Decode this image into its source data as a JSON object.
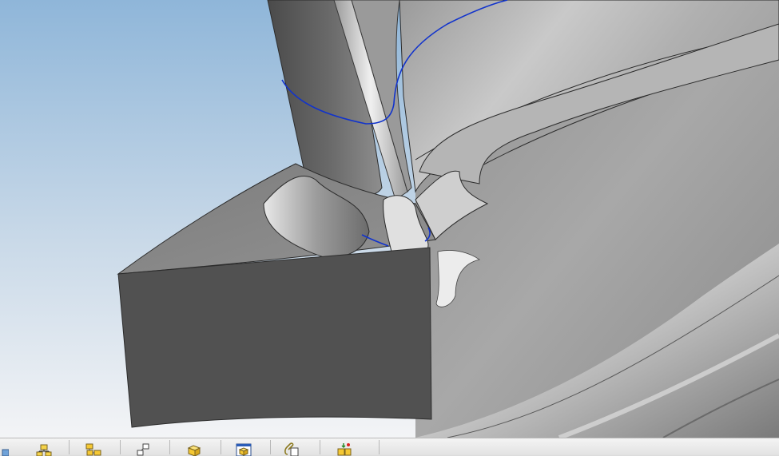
{
  "app": {
    "view": "3d-model-viewport",
    "colors": {
      "background_top": "#8fb6d9",
      "background_bottom": "#f3f4f6",
      "edge_curve": "#1133cc",
      "surface_dark": "#515151",
      "surface_light": "#cfcfcf"
    }
  },
  "toolbar": {
    "buttons": [
      {
        "name": "partial-icon-button",
        "icon": "cube-edge-icon"
      },
      {
        "name": "assembly-tree-button",
        "icon": "hierarchy-icon"
      },
      {
        "name": "components-button",
        "icon": "yellow-blocks-icon"
      },
      {
        "name": "constraint-button",
        "icon": "node-link-icon"
      },
      {
        "name": "part-button",
        "icon": "yellow-cube-icon"
      },
      {
        "name": "document-button",
        "icon": "doc-cube-icon"
      },
      {
        "name": "attach-button",
        "icon": "paperclip-doc-icon"
      },
      {
        "name": "explode-button",
        "icon": "explode-icon"
      }
    ]
  }
}
